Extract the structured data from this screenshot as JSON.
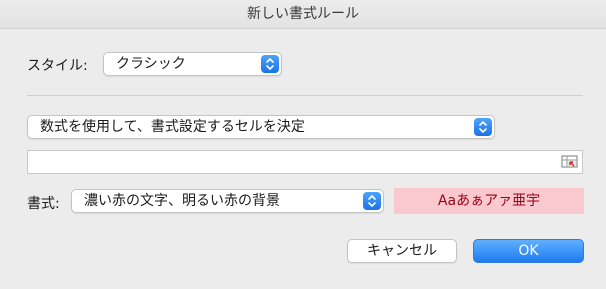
{
  "window": {
    "title": "新しい書式ルール"
  },
  "style_row": {
    "label": "スタイル:",
    "selected": "クラシック"
  },
  "rule_row": {
    "selected": "数式を使用して、書式設定するセルを決定"
  },
  "formula": {
    "value": ""
  },
  "format_row": {
    "label": "書式:",
    "selected": "濃い赤の文字、明るい赤の背景",
    "preview_text": "Aaあぁアァ亜宇"
  },
  "buttons": {
    "cancel": "キャンセル",
    "ok": "OK"
  },
  "colors": {
    "accent": "#1a73e8",
    "preview_background": "#f9c9cf",
    "preview_text": "#9c0018"
  },
  "icons": {
    "popup_arrows": "updown-chevron-icon",
    "range_picker": "cell-range-picker-icon"
  }
}
